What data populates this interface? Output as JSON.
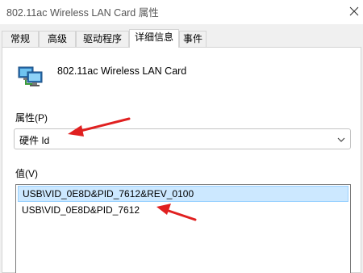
{
  "window": {
    "title": "802.11ac Wireless LAN Card 属性"
  },
  "tabs": [
    {
      "label": "常规",
      "active": false
    },
    {
      "label": "高级",
      "active": false
    },
    {
      "label": "驱动程序",
      "active": false
    },
    {
      "label": "详细信息",
      "active": true
    },
    {
      "label": "事件",
      "active": false
    }
  ],
  "device": {
    "icon": "network-adapter-icon",
    "name": "802.11ac Wireless LAN Card"
  },
  "property": {
    "label": "属性(P)",
    "selected": "硬件 Id"
  },
  "value": {
    "label": "值(V)",
    "items": [
      {
        "text": "USB\\VID_0E8D&PID_7612&REV_0100",
        "selected": true
      },
      {
        "text": "USB\\VID_0E8D&PID_7612",
        "selected": false
      }
    ]
  },
  "colors": {
    "annotation_arrow": "#e02020",
    "selection_fill": "#cce8ff",
    "selection_border": "#99d1ff"
  }
}
